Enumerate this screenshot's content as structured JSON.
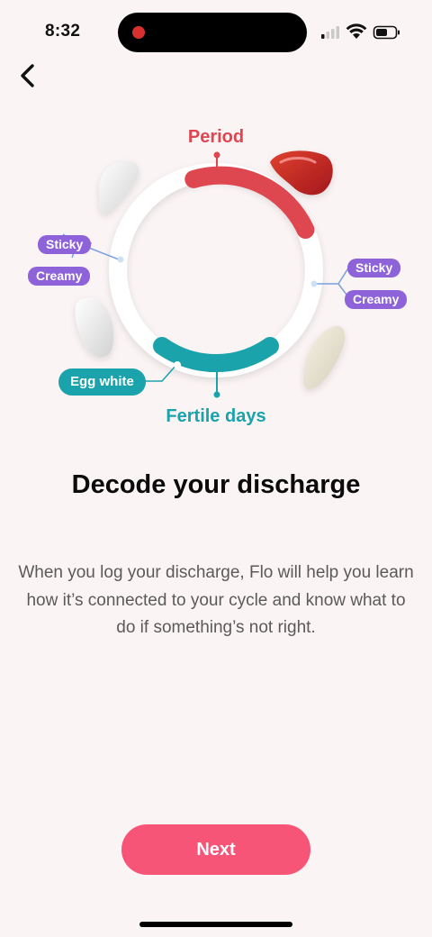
{
  "status_bar": {
    "time": "8:32",
    "icons": [
      "recording-dot-icon",
      "cellular-signal-icon",
      "wifi-icon",
      "battery-icon"
    ]
  },
  "nav": {
    "back_icon": "chevron-left-icon"
  },
  "illustration": {
    "period_label": "Period",
    "fertile_label": "Fertile days",
    "left_labels": [
      "Sticky",
      "Creamy"
    ],
    "right_labels": [
      "Sticky",
      "Creamy"
    ],
    "egg_white_label": "Egg white",
    "colors": {
      "period": "#de4650",
      "fertile": "#1aa3ab",
      "label": "#8e62d8"
    }
  },
  "content": {
    "title": "Decode your discharge",
    "description": "When you log your discharge, Flo will help you learn how it’s connected to your cycle and know what to do if something’s not right."
  },
  "actions": {
    "next_label": "Next",
    "accent": "#f75577"
  }
}
